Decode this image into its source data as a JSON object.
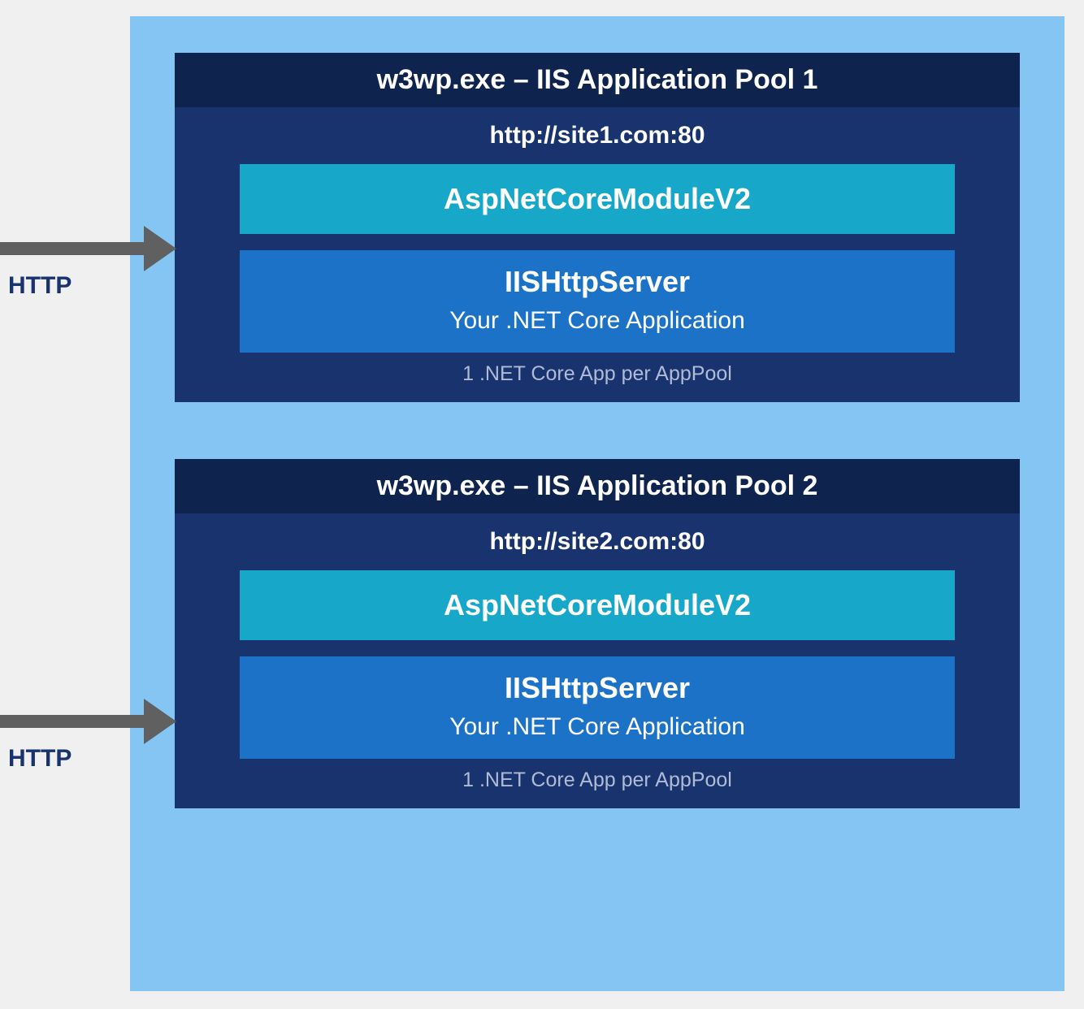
{
  "http_label": "HTTP",
  "pools": [
    {
      "header": "w3wp.exe – IIS Application Pool 1",
      "site": "http://site1.com:80",
      "module": "AspNetCoreModuleV2",
      "server_title": "IISHttpServer",
      "server_sub": "Your .NET Core Application",
      "note": "1 .NET Core App per AppPool"
    },
    {
      "header": "w3wp.exe – IIS Application Pool 2",
      "site": "http://site2.com:80",
      "module": "AspNetCoreModuleV2",
      "server_title": "IISHttpServer",
      "server_sub": "Your .NET Core Application",
      "note": "1 .NET Core App per AppPool"
    }
  ],
  "colors": {
    "container_bg": "#84c5f4",
    "pool_bg": "#18336e",
    "pool_header_bg": "#0f234f",
    "module_bg": "#17a8c9",
    "server_bg": "#1b72c6",
    "arrow": "#606060",
    "http_text": "#18336e"
  }
}
